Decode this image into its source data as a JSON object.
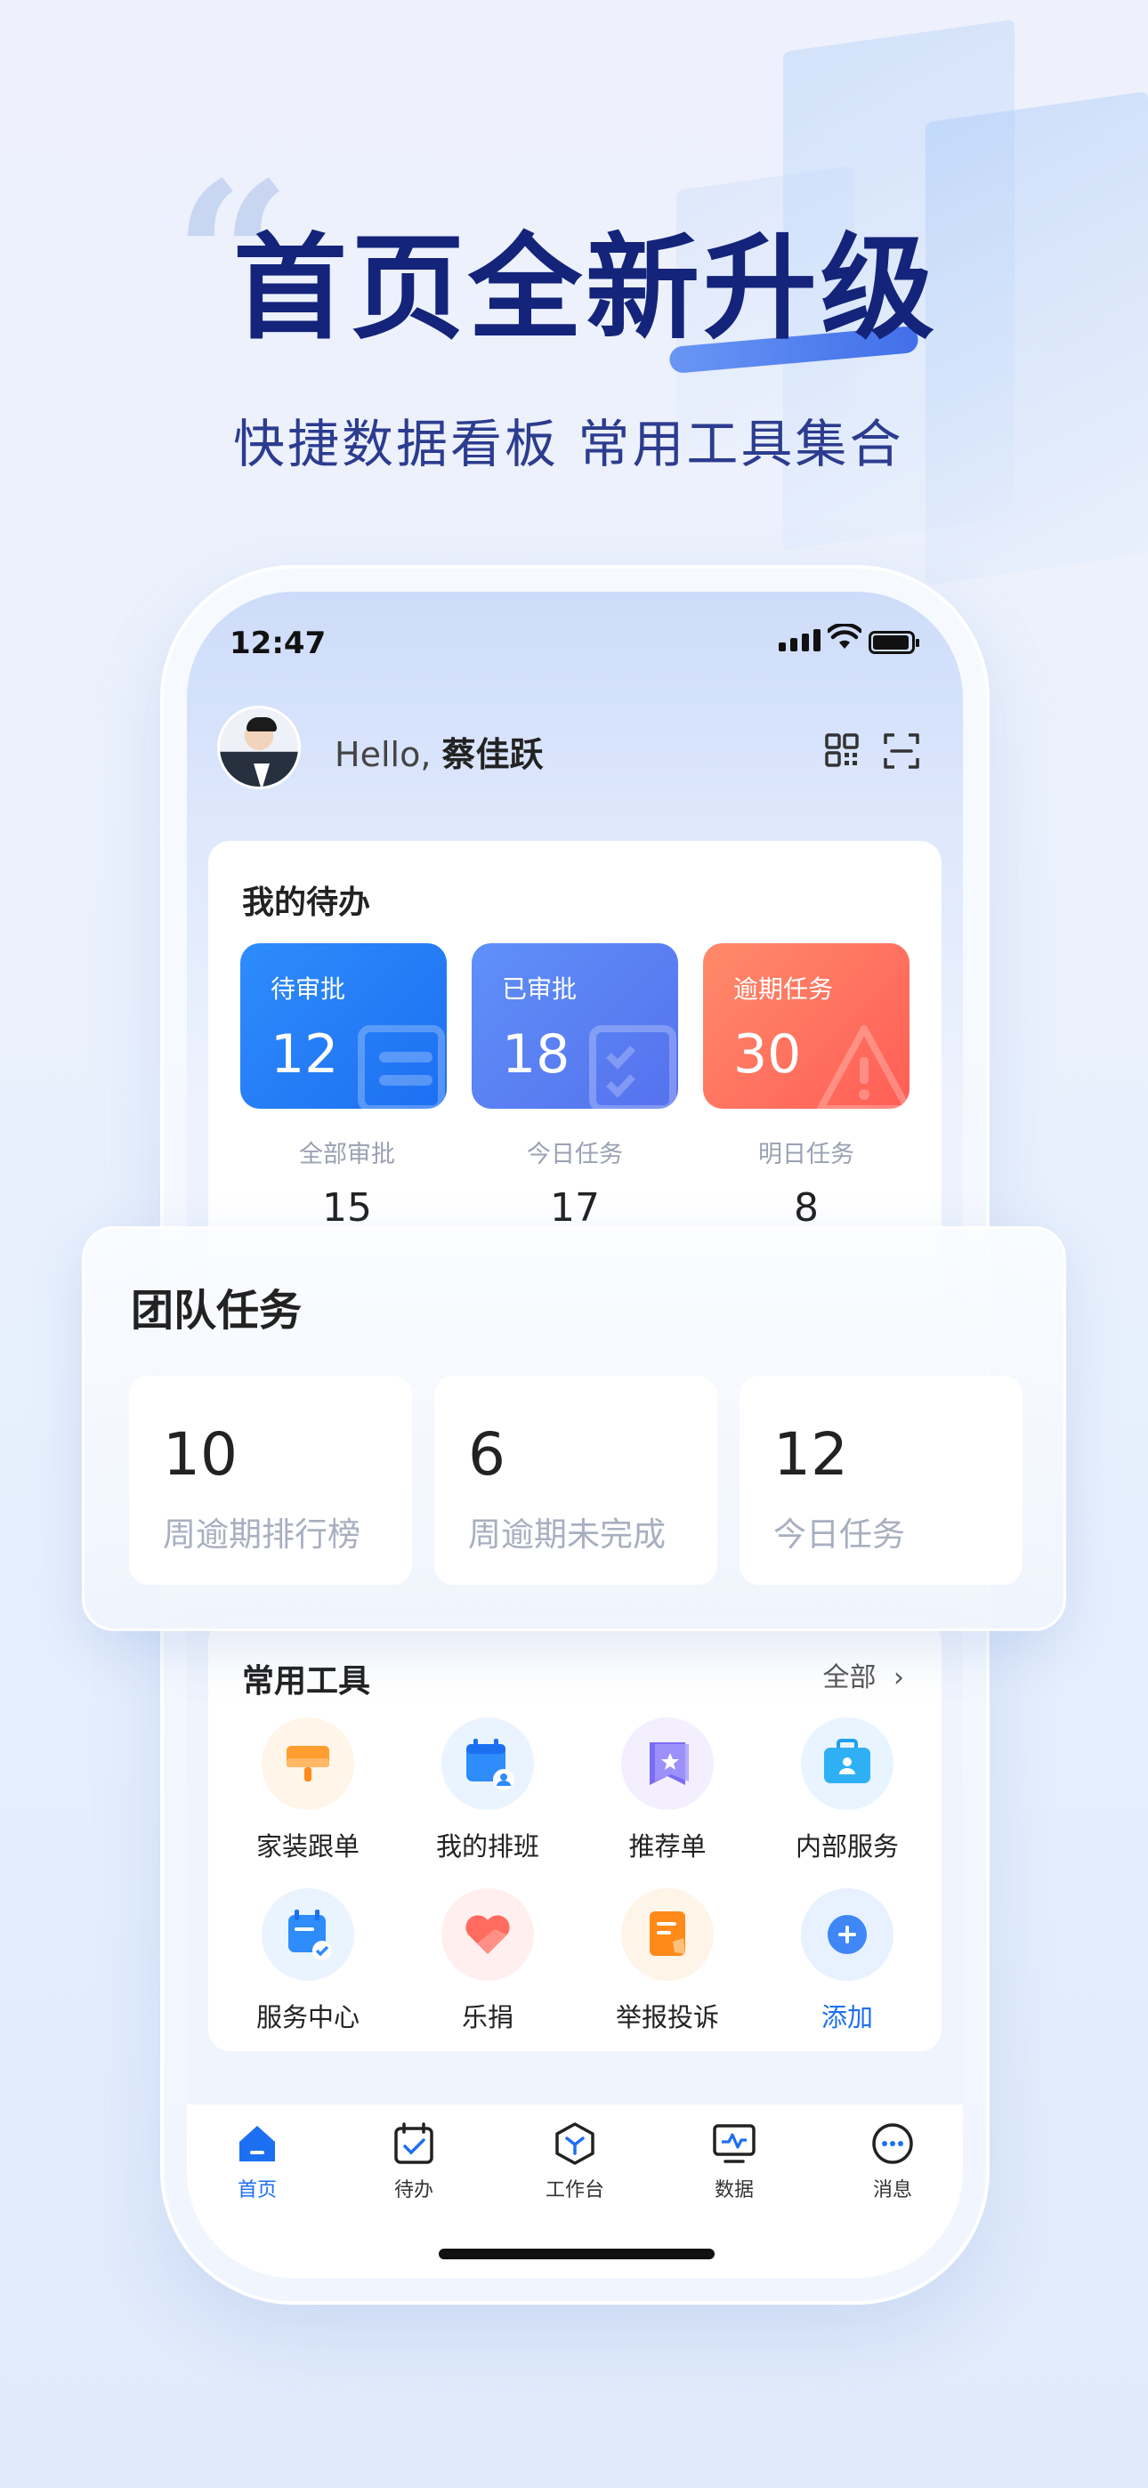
{
  "hero": {
    "title": "首页全新升级",
    "subtitle": "快捷数据看板 常用工具集合",
    "quote_glyph": "“"
  },
  "status_bar": {
    "time": "12:47"
  },
  "header": {
    "greeting": "Hello,",
    "user_name": "蔡佳跃"
  },
  "todo": {
    "title": "我的待办",
    "tiles": [
      {
        "label": "待审批",
        "value": "12",
        "color": "#1d6ff2"
      },
      {
        "label": "已审批",
        "value": "18",
        "color": "#5571ee"
      },
      {
        "label": "逾期任务",
        "value": "30",
        "color": "#ff5e55"
      }
    ],
    "stats": [
      {
        "label": "全部审批",
        "value": "15"
      },
      {
        "label": "今日任务",
        "value": "17"
      },
      {
        "label": "明日任务",
        "value": "8"
      }
    ]
  },
  "team": {
    "title": "团队任务",
    "stats": [
      {
        "value": "10",
        "label": "周逾期排行榜"
      },
      {
        "value": "6",
        "label": "周逾期未完成"
      },
      {
        "value": "12",
        "label": "今日任务"
      }
    ]
  },
  "tools": {
    "title": "常用工具",
    "all_label": "全部",
    "items": [
      {
        "label": "家装跟单",
        "icon": "paint-roller-icon"
      },
      {
        "label": "我的排班",
        "icon": "calendar-user-icon"
      },
      {
        "label": "推荐单",
        "icon": "bookmark-star-icon"
      },
      {
        "label": "内部服务",
        "icon": "briefcase-user-icon"
      },
      {
        "label": "服务中心",
        "icon": "calendar-check-icon"
      },
      {
        "label": "乐捐",
        "icon": "heart-hand-icon"
      },
      {
        "label": "举报投诉",
        "icon": "report-doc-icon"
      },
      {
        "label": "添加",
        "icon": "plus-circle-icon"
      }
    ]
  },
  "tabbar": {
    "tabs": [
      {
        "label": "首页",
        "icon": "home-icon",
        "active": true
      },
      {
        "label": "待办",
        "icon": "todo-calendar-icon",
        "active": false
      },
      {
        "label": "工作台",
        "icon": "workbench-icon",
        "active": false
      },
      {
        "label": "数据",
        "icon": "data-monitor-icon",
        "active": false
      },
      {
        "label": "消息",
        "icon": "message-icon",
        "active": false
      }
    ]
  },
  "colors": {
    "accent": "#1d6ff2",
    "hero_title": "#14247a",
    "muted_text": "#9aa1b3"
  }
}
